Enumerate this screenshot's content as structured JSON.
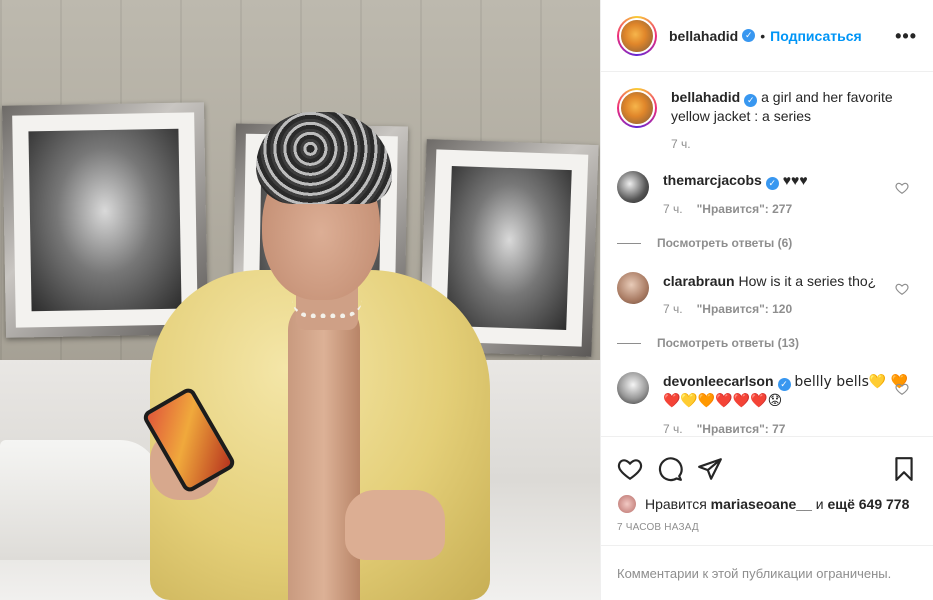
{
  "post": {
    "author": "bellahadid",
    "follow_label": "Подписаться",
    "more_label": "•••"
  },
  "caption": {
    "author": "bellahadid",
    "text": "a girl and her favorite yellow jacket : a series",
    "time": "7 ч."
  },
  "comments": [
    {
      "author": "themarcjacobs",
      "verified": true,
      "text": "♥♥♥",
      "time": "7 ч.",
      "likes": "\"Нравится\": 277",
      "replies": "Посмотреть ответы (6)"
    },
    {
      "author": "clarabraun",
      "verified": false,
      "text": "How is it a series tho¿",
      "time": "7 ч.",
      "likes": "\"Нравится\": 120",
      "replies": "Посмотреть ответы (13)"
    },
    {
      "author": "devonleecarlson",
      "verified": true,
      "text": "bellly bells💛 🧡❤️💛🧡❤️❤️❤️😟",
      "time": "7 ч.",
      "likes": "\"Нравится\": 77"
    }
  ],
  "likes_summary": {
    "prefix": "Нравится",
    "user": "mariaseoane__",
    "conjunction": "и",
    "others": "ещё 649 778"
  },
  "date_label": "7 ЧАСОВ НАЗАД",
  "comments_disabled": "Комментарии к этой публикации ограничены.",
  "icons": {
    "like": "heart-icon",
    "comment": "comment-icon",
    "share": "share-icon",
    "save": "bookmark-icon",
    "verified": "verified-badge-icon"
  },
  "colors": {
    "follow": "#0095f6",
    "verified": "#3897f0",
    "muted": "#8e8e8e",
    "text": "#262626"
  }
}
